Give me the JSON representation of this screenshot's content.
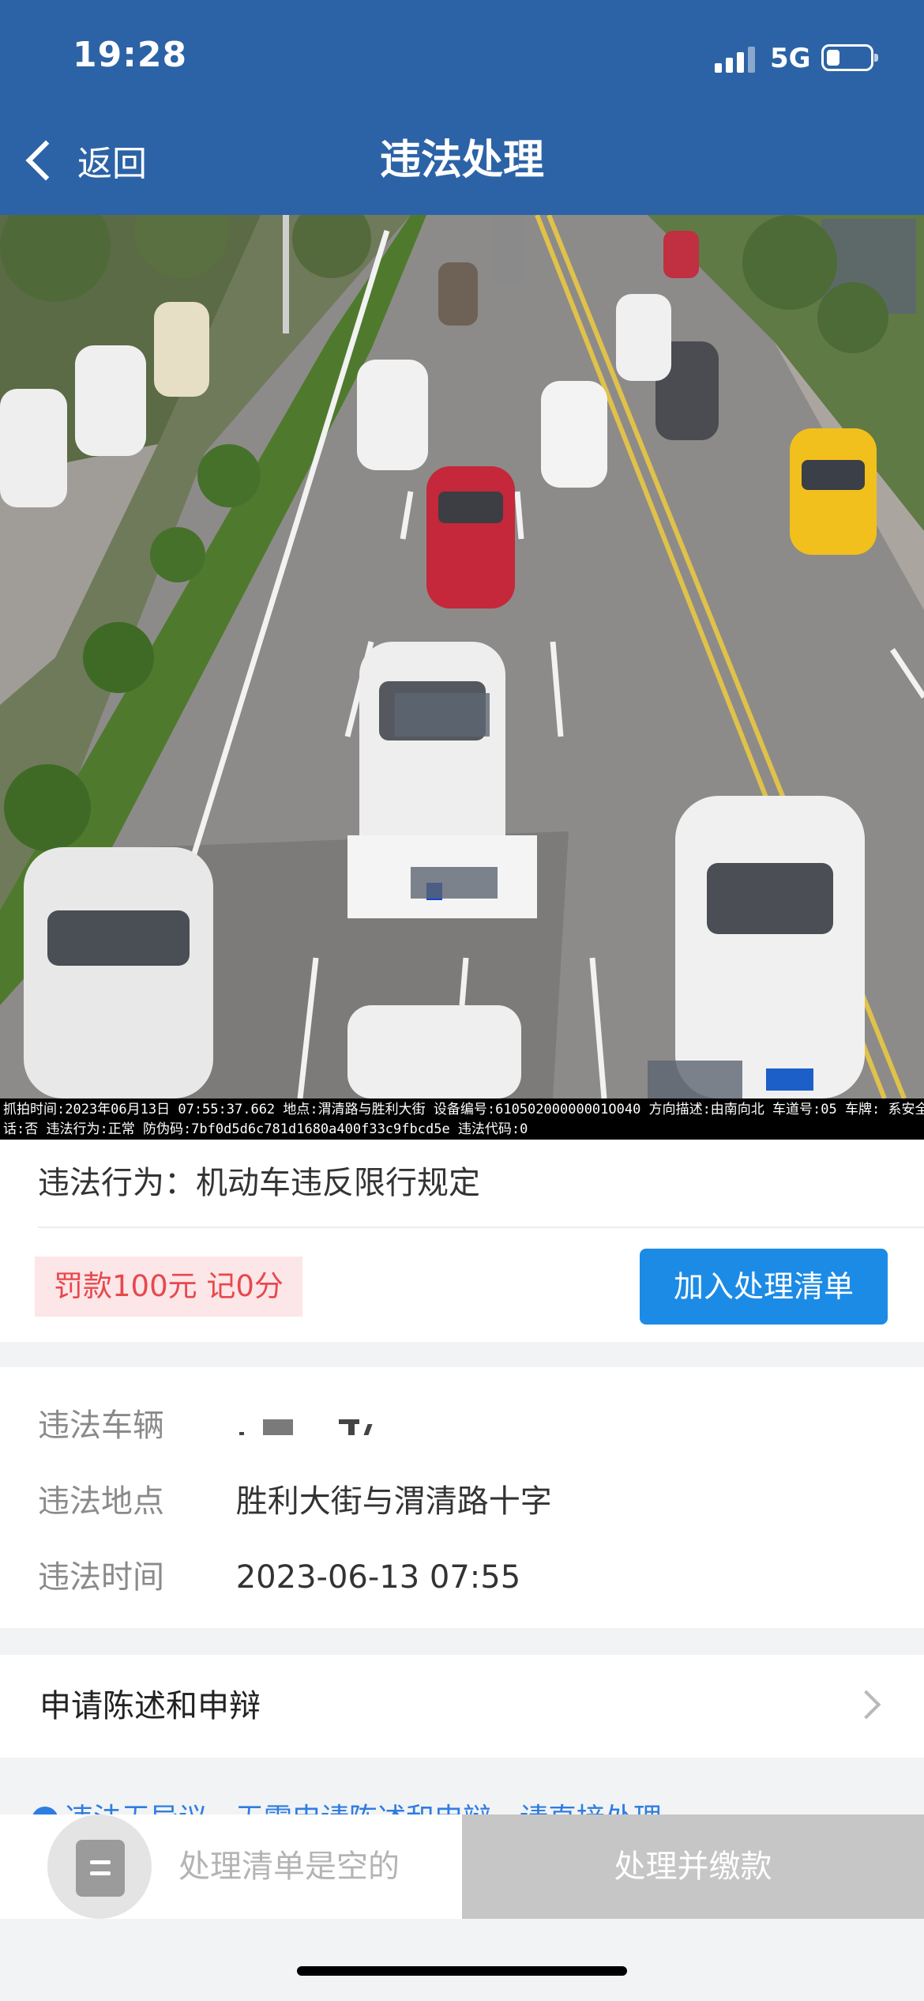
{
  "status_bar": {
    "time": "19:28",
    "network": "5G",
    "battery_percent": 30
  },
  "nav": {
    "back_label": "返回",
    "title": "违法处理"
  },
  "photo": {
    "caption_line1": "抓拍时间:2023年06月13日 07:55:37.662 地点:渭清路与胜利大街 设备编号:61050200000001O040 方向描述:由南向北 车道号:05 车牌:           系安全带:主驾驶是 副驾驶未知 打电",
    "caption_line2": "话:否 违法行为:正常 防伪码:7bf0d5d6c781d1680a400f33c9fbcd5e 违法代码:0"
  },
  "violation": {
    "behavior": "违法行为：机动车违反限行规定",
    "fine_tag": "罚款100元  记0分",
    "add_button": "加入处理清单"
  },
  "details": {
    "vehicle_label": "违法车辆",
    "location_label": "违法地点",
    "location_value": "胜利大街与渭清路十字",
    "time_label": "违法时间",
    "time_value": "2023-06-13 07:55"
  },
  "appeal": {
    "label": "申请陈述和申辩"
  },
  "hint": {
    "text": "违法无异议，无需申请陈述和申辩，请直接处理"
  },
  "bottom_bar": {
    "empty_text": "处理清单是空的",
    "pay_button": "处理并缴款"
  }
}
